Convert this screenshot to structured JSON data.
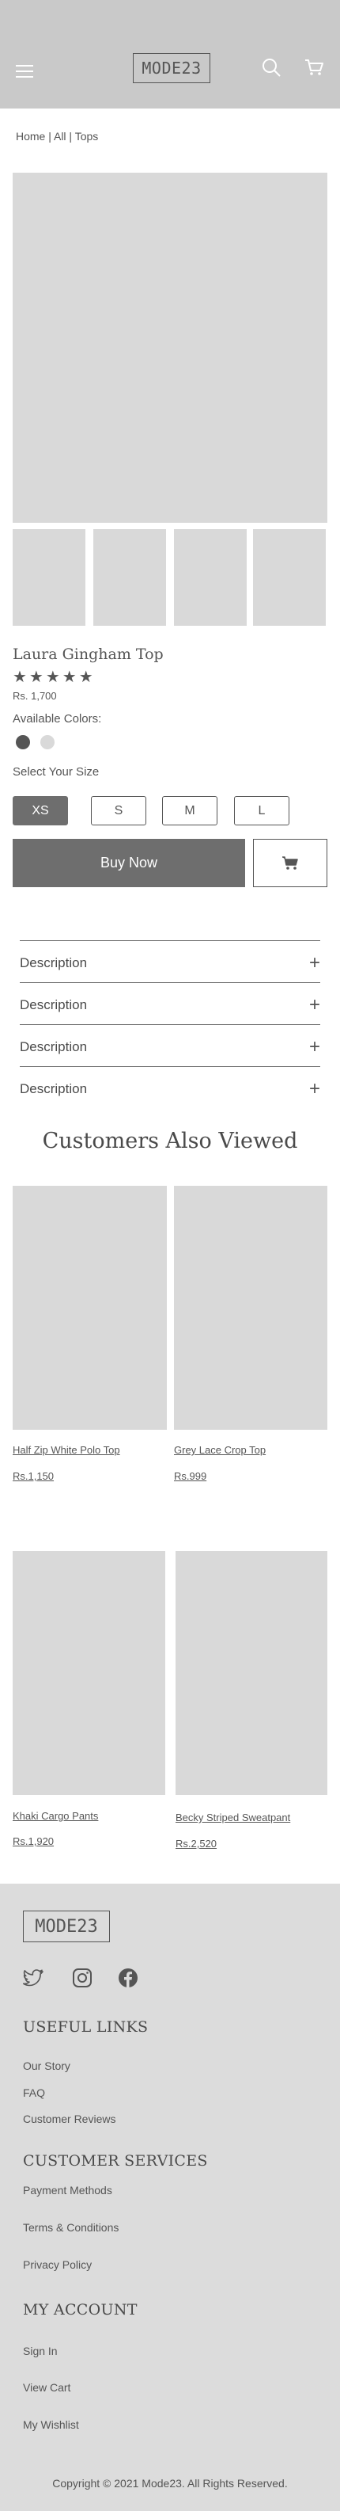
{
  "header": {
    "logo": "MODE23"
  },
  "breadcrumb": "Home | All | Tops",
  "product": {
    "title": "Laura Gingham Top",
    "rating": 5,
    "stars": "★★★★★",
    "price": "Rs. 1,700",
    "colors_label": "Available Colors:",
    "colors": [
      "#555555",
      "#d9d9d9"
    ],
    "size_label": "Select Your Size",
    "sizes": [
      "XS",
      "S",
      "M",
      "L"
    ],
    "selected_size": "XS",
    "buy_label": "Buy Now"
  },
  "accordion": [
    "Description",
    "Description",
    "Description",
    "Description"
  ],
  "also_viewed": {
    "title": "Customers Also Viewed",
    "items": [
      {
        "name": "Half Zip White Polo Top",
        "price": "Rs.1,150"
      },
      {
        "name": "Grey Lace Crop Top",
        "price": "Rs.999"
      },
      {
        "name": "Khaki Cargo Pants",
        "price": "Rs.1,920"
      },
      {
        "name": "Becky Striped Sweatpant",
        "price": "Rs.2,520"
      }
    ]
  },
  "footer": {
    "logo": "MODE23",
    "useful_links": {
      "title": "USEFUL LINKS",
      "items": [
        "Our Story",
        "FAQ",
        "Customer Reviews"
      ]
    },
    "customer_services": {
      "title": "CUSTOMER SERVICES",
      "items": [
        "Payment Methods",
        "Terms & Conditions",
        "Privacy Policy"
      ]
    },
    "my_account": {
      "title": "MY ACCOUNT",
      "items": [
        "Sign In",
        "View Cart",
        "My Wishlist"
      ]
    },
    "copyright": "Copyright © 2021 Mode23. All Rights Reserved."
  },
  "colors": {
    "header_bg": "#c9c9c9",
    "footer_bg": "#dcdcdc",
    "placeholder": "#d9d9d9",
    "dark": "#6e6e6e"
  },
  "icons": [
    "menu-icon",
    "search-icon",
    "cart-icon",
    "twitter-icon",
    "instagram-icon",
    "facebook-icon",
    "plus-icon"
  ]
}
